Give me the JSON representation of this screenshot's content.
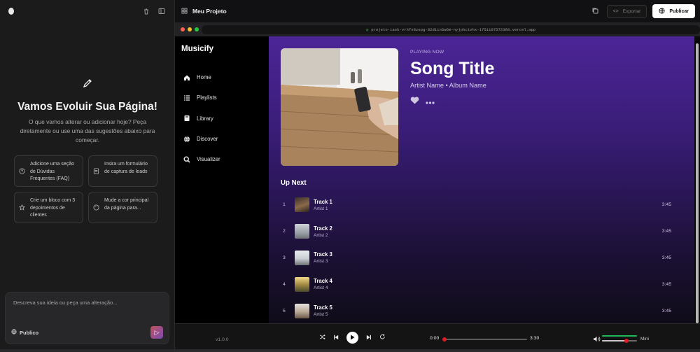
{
  "left_panel": {
    "heading": "Vamos Evoluir Sua Página!",
    "description": "O que vamos alterar ou adicionar hoje? Peça diretamente ou use uma das sugestões abaixo para começar.",
    "suggestions": [
      {
        "text": "Adicione uma seção de Dúvidas Frequentes (FAQ)",
        "icon": "help-circle-icon"
      },
      {
        "text": "Insira um formulário de captura de leads",
        "icon": "form-icon"
      },
      {
        "text": "Crie um bloco com 3 depoimentos de clientes",
        "icon": "star-icon"
      },
      {
        "text": "Mude a cor principal da página para...",
        "icon": "palette-icon"
      }
    ],
    "composer_placeholder": "Descreva sua ideia ou peça uma alteração...",
    "visibility_label": "Publico"
  },
  "header": {
    "project_title": "Meu Projeto",
    "export_label": "Exportar",
    "publish_label": "Publicar"
  },
  "browser": {
    "url": "projeto-task-vrhfx8zepg-82d1in6w6m-nyjphctvhx-1751107572368.vercel.app"
  },
  "site": {
    "brand": "Musicify",
    "nav": [
      {
        "label": "Home",
        "icon": "home-icon"
      },
      {
        "label": "Playlists",
        "icon": "list-icon"
      },
      {
        "label": "Library",
        "icon": "book-icon"
      },
      {
        "label": "Discover",
        "icon": "globe-icon"
      },
      {
        "label": "Visualizer",
        "icon": "search-icon"
      }
    ],
    "now_playing": {
      "label": "PLAYING NOW",
      "title": "Song Title",
      "subtitle": "Artist Name • Album Name"
    },
    "up_next_title": "Up Next",
    "tracks": [
      {
        "num": "1",
        "title": "Track 1",
        "artist": "Artist 1",
        "duration": "3:45"
      },
      {
        "num": "2",
        "title": "Track 2",
        "artist": "Artist 2",
        "duration": "3:45"
      },
      {
        "num": "3",
        "title": "Track 3",
        "artist": "Artist 3",
        "duration": "3:45"
      },
      {
        "num": "4",
        "title": "Track 4",
        "artist": "Artist 4",
        "duration": "3:45"
      },
      {
        "num": "5",
        "title": "Track 5",
        "artist": "Artist 5",
        "duration": "3:45"
      }
    ],
    "player": {
      "version": "v1.0.0",
      "current_time": "0:00",
      "total_time": "3:30",
      "progress": 0,
      "volume": 0.7,
      "mini_label": "Mini"
    }
  },
  "colors": {
    "accent": "#e01b24",
    "volume": "#1db954",
    "gradient_top": "#4b2596"
  }
}
